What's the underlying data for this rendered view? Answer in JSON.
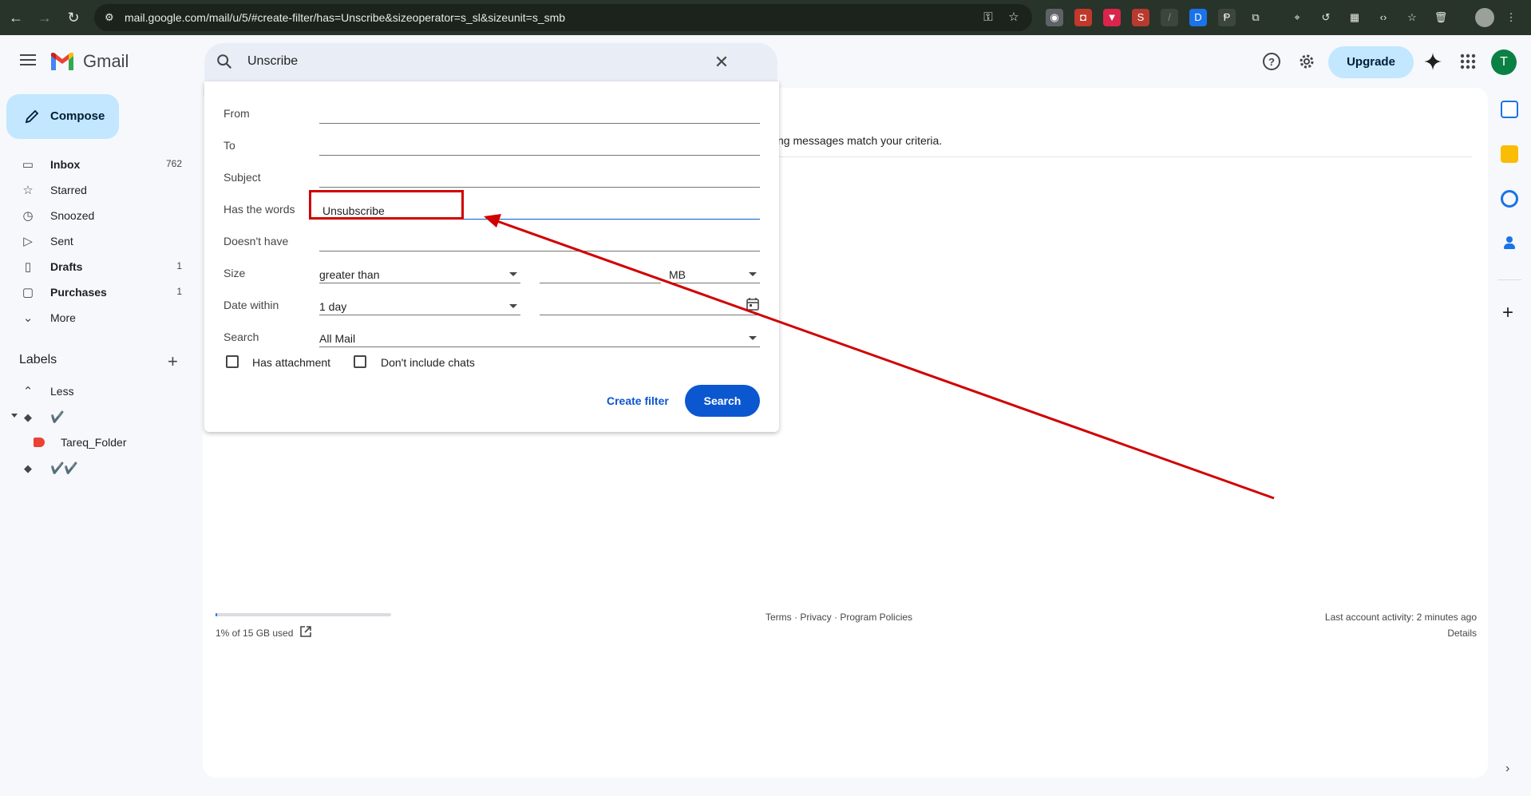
{
  "browser": {
    "url": "mail.google.com/mail/u/5/#create-filter/has=Unscribe&sizeoperator=s_sl&sizeunit=s_smb"
  },
  "header": {
    "brand": "Gmail",
    "search_query": "Unscribe",
    "upgrade_label": "Upgrade",
    "profile_initial": "T"
  },
  "sidebar": {
    "compose_label": "Compose",
    "items": [
      {
        "label": "Inbox",
        "count": "762",
        "icon": "inbox-icon"
      },
      {
        "label": "Starred",
        "count": "",
        "icon": "star-icon"
      },
      {
        "label": "Snoozed",
        "count": "",
        "icon": "clock-icon"
      },
      {
        "label": "Sent",
        "count": "",
        "icon": "send-icon"
      },
      {
        "label": "Drafts",
        "count": "1",
        "icon": "draft-icon"
      },
      {
        "label": "Purchases",
        "count": "1",
        "icon": "purchases-icon"
      },
      {
        "label": "More",
        "count": "",
        "icon": "chevron-down-icon"
      }
    ],
    "labels_title": "Labels",
    "label_items": [
      {
        "label": "Less"
      },
      {
        "label": "✔️"
      },
      {
        "label": "Tareq_Folder"
      },
      {
        "label": "✔️✔️"
      }
    ]
  },
  "filter": {
    "from_label": "From",
    "to_label": "To",
    "subject_label": "Subject",
    "has_words_label": "Has the words",
    "has_words_value": "Unsubscribe",
    "doesnt_have_label": "Doesn't have",
    "size_label": "Size",
    "size_operator": "greater than",
    "size_unit": "MB",
    "date_within_label": "Date within",
    "date_within_value": "1 day",
    "search_label": "Search",
    "search_scope": "All Mail",
    "has_attachment_label": "Has attachment",
    "dont_include_chats_label": "Don't include chats",
    "create_filter_label": "Create filter",
    "search_button_label": "Search"
  },
  "main": {
    "message": "ng messages match your criteria.",
    "storage_text": "1% of 15 GB used",
    "storage_used_fraction": 0.01,
    "footer_links": "Terms · Privacy · Program Policies",
    "last_activity": "Last account activity: 2 minutes ago",
    "details": "Details"
  },
  "annotation": {
    "color": "#d10000"
  }
}
